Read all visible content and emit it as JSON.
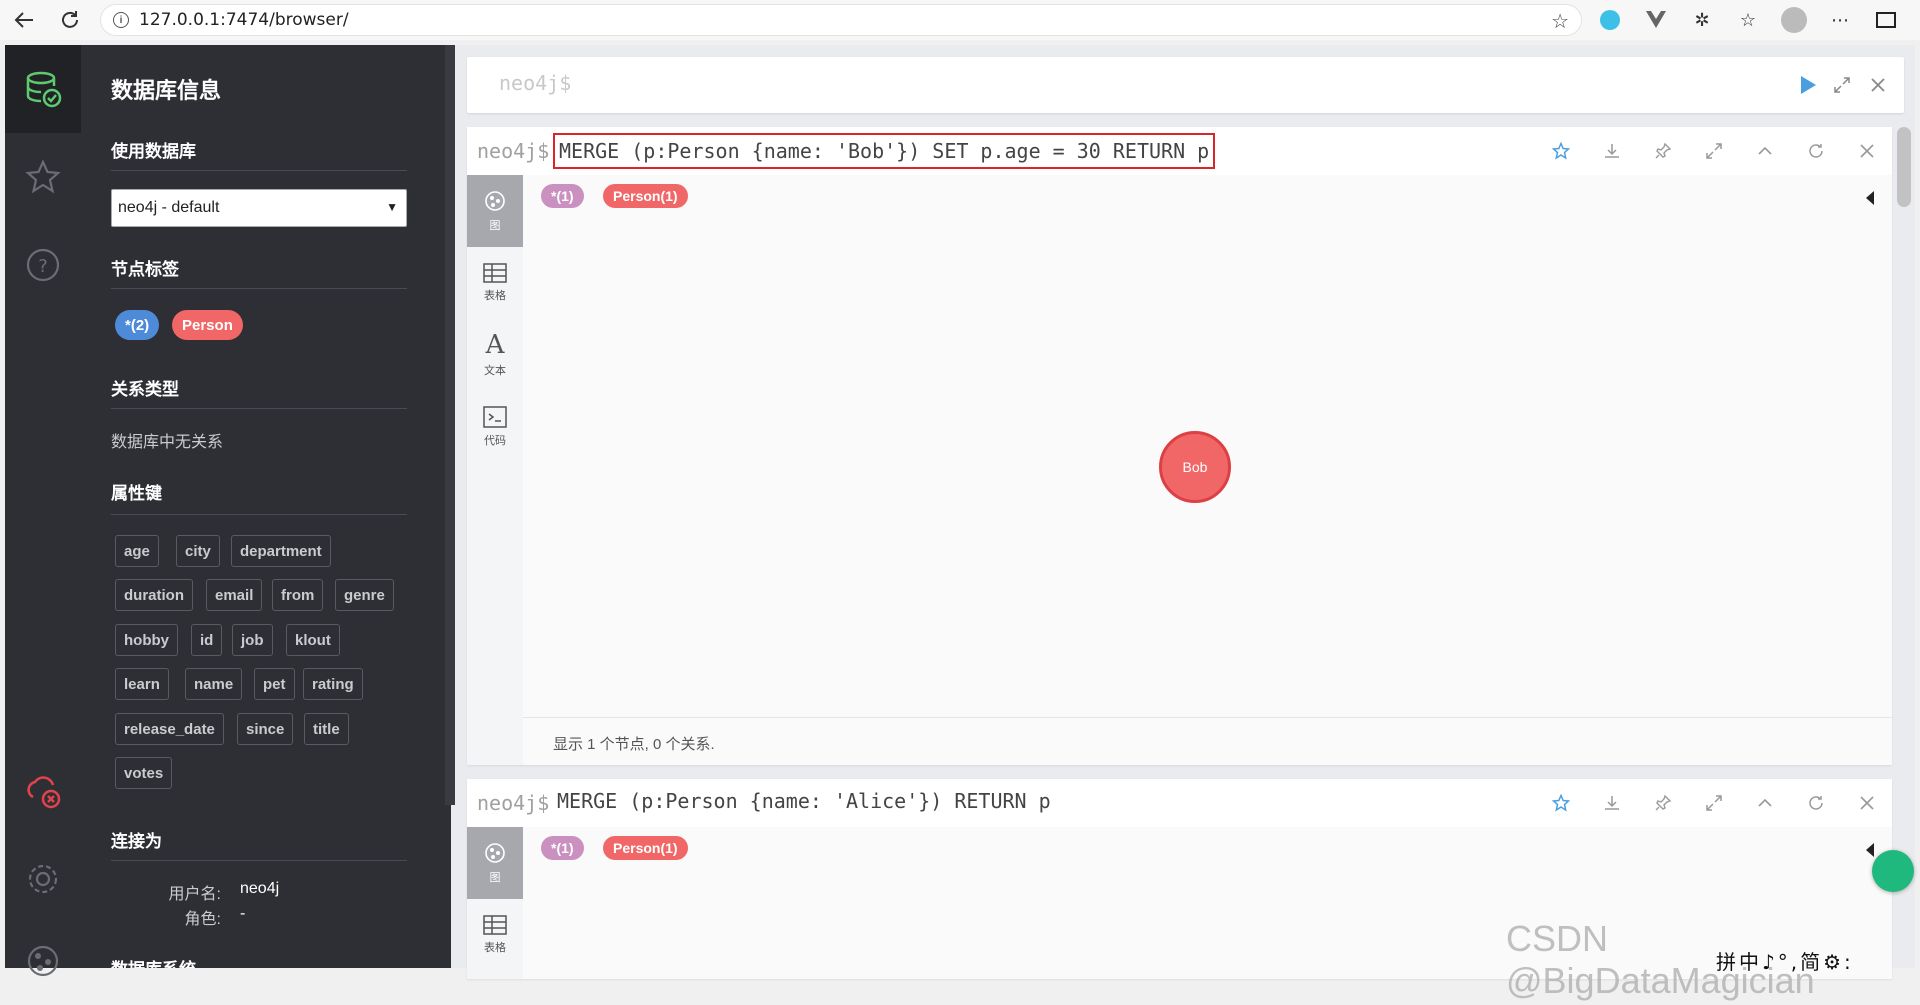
{
  "browser": {
    "url": "127.0.0.1:7474/browser/"
  },
  "drawer": {
    "title": "数据库信息",
    "use_db_label": "使用数据库",
    "db_selected": "neo4j - default",
    "node_labels_title": "节点标签",
    "node_labels": [
      {
        "text": "*(2)",
        "color": "#4d8bd9"
      },
      {
        "text": "Person",
        "color": "#f16667"
      }
    ],
    "rel_types_title": "关系类型",
    "rel_types_empty": "数据库中无关系",
    "prop_keys_title": "属性键",
    "prop_keys": [
      "age",
      "city",
      "department",
      "duration",
      "email",
      "from",
      "genre",
      "hobby",
      "id",
      "job",
      "klout",
      "learn",
      "name",
      "pet",
      "rating",
      "release_date",
      "since",
      "title",
      "votes"
    ],
    "connected_title": "连接为",
    "username_label": "用户名:",
    "username": "neo4j",
    "role_label": "角色:",
    "role": "-",
    "db_system_title": "数据库系统"
  },
  "editor": {
    "prompt": "neo4j$"
  },
  "frames": [
    {
      "prompt": "neo4j$",
      "query": "MERGE (p:Person {name: 'Bob'}) SET p.age = 30 RETURN p",
      "tabs": [
        "图",
        "表格",
        "文本",
        "代码"
      ],
      "badges": [
        {
          "text": "*(1)",
          "color": "#c990c0"
        },
        {
          "text": "Person(1)",
          "color": "#f16667"
        }
      ],
      "node": "Bob",
      "status": "显示 1 个节点, 0 个关系."
    },
    {
      "prompt": "neo4j$",
      "query": "MERGE (p:Person {name: 'Alice'}) RETURN p",
      "tabs": [
        "图",
        "表格"
      ],
      "badges": [
        {
          "text": "*(1)",
          "color": "#c990c0"
        },
        {
          "text": "Person(1)",
          "color": "#f16667"
        }
      ]
    }
  ],
  "watermark": "CSDN @BigDataMagician",
  "ime": "拼中♪°,简⚙:"
}
